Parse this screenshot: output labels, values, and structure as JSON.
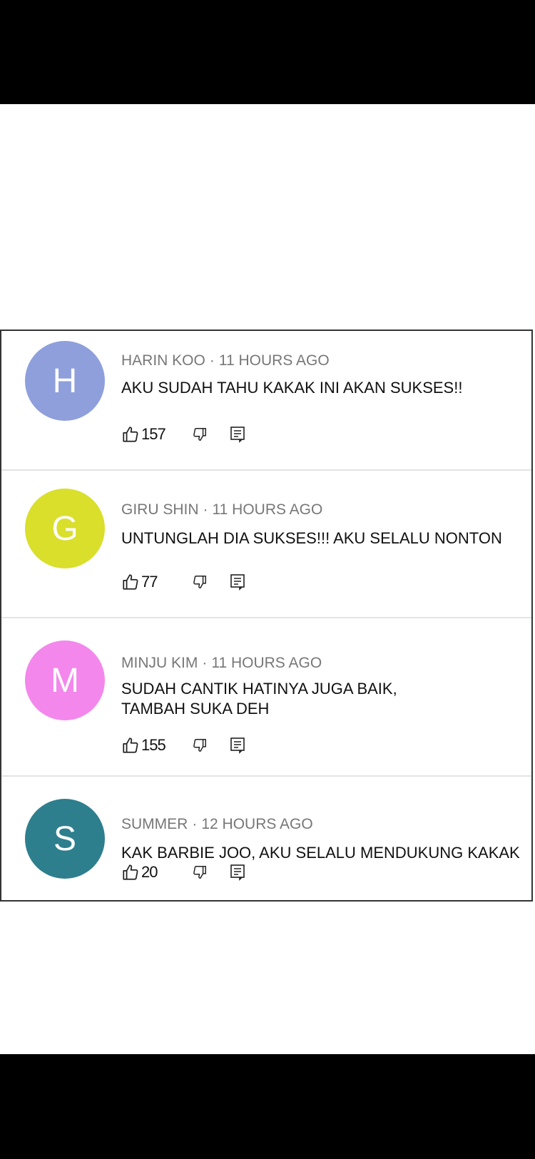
{
  "comments": [
    {
      "initial": "H",
      "color": "#8e9fdc",
      "author": "HARIN KOO",
      "time": "11 HOURS AGO",
      "text": "AKU SUDAH TAHU KAKAK INI AKAN SUKSES!!",
      "likes": "157"
    },
    {
      "initial": "G",
      "color": "#d9df2b",
      "author": "GIRU SHIN",
      "time": "11 HOURS AGO",
      "text": "UNTUNGLAH DIA SUKSES!!! AKU SELALU NONTON",
      "likes": "77"
    },
    {
      "initial": "M",
      "color": "#f387ec",
      "author": "MINJU KIM",
      "time": "11 HOURS AGO",
      "text": "SUDAH CANTIK HATINYA JUGA BAIK,\nTAMBAH SUKA DEH",
      "likes": "155"
    },
    {
      "initial": "S",
      "color": "#2e7f8e",
      "author": "SUMMER",
      "time": "12 HOURS AGO",
      "text": "KAK BARBIE JOO, AKU SELALU MENDUKUNG KAKAK",
      "likes": "20"
    }
  ],
  "separator": "·",
  "icons": {
    "like": "thumbs-up-icon",
    "dislike": "thumbs-down-icon",
    "reply": "reply-icon"
  }
}
